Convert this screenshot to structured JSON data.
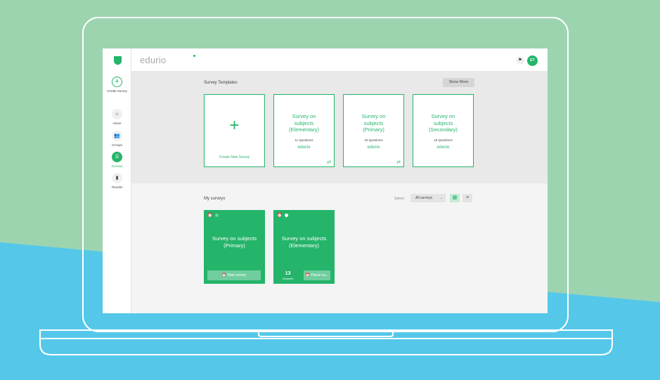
{
  "colors": {
    "brand_green": "#24b46a",
    "backdrop_top": "#9dd4b0",
    "backdrop_bottom": "#55c8ea"
  },
  "sidebar": {
    "create_label": "Create Survey",
    "items": [
      {
        "label": "Home",
        "icon": "home-icon",
        "glyph": "⌂"
      },
      {
        "label": "Groups",
        "icon": "groups-icon",
        "glyph": "👥"
      },
      {
        "label": "Surveys",
        "icon": "surveys-icon",
        "glyph": "☰",
        "active": true
      },
      {
        "label": "Results",
        "icon": "results-icon",
        "glyph": "▮"
      }
    ]
  },
  "header": {
    "brand": "edurio",
    "avatar_initials": "ET",
    "flag_glyph": "⚑"
  },
  "templates": {
    "title": "Survey Templates",
    "show_more": "Show More",
    "create_label": "Create New Survey",
    "cards": [
      {
        "title": "Survey on subjects (Elementary)",
        "count": "11 Questions",
        "brand": "edurio"
      },
      {
        "title": "Survey on subjects (Primary)",
        "count": "18 Questions",
        "brand": "edurio"
      },
      {
        "title": "Survey on subjects (Secondary)",
        "count": "18 Questions",
        "brand": "edurio"
      }
    ]
  },
  "my_surveys": {
    "title": "My surveys",
    "select_label": "Select",
    "select_value": "All surveys",
    "cards": [
      {
        "title": "Survey on subjects (Primary)",
        "button": "Start survey"
      },
      {
        "title": "Survey on subjects (Elementary)",
        "answers_count": "13",
        "answers_label": "Answers",
        "button": "Pause su..."
      }
    ]
  }
}
